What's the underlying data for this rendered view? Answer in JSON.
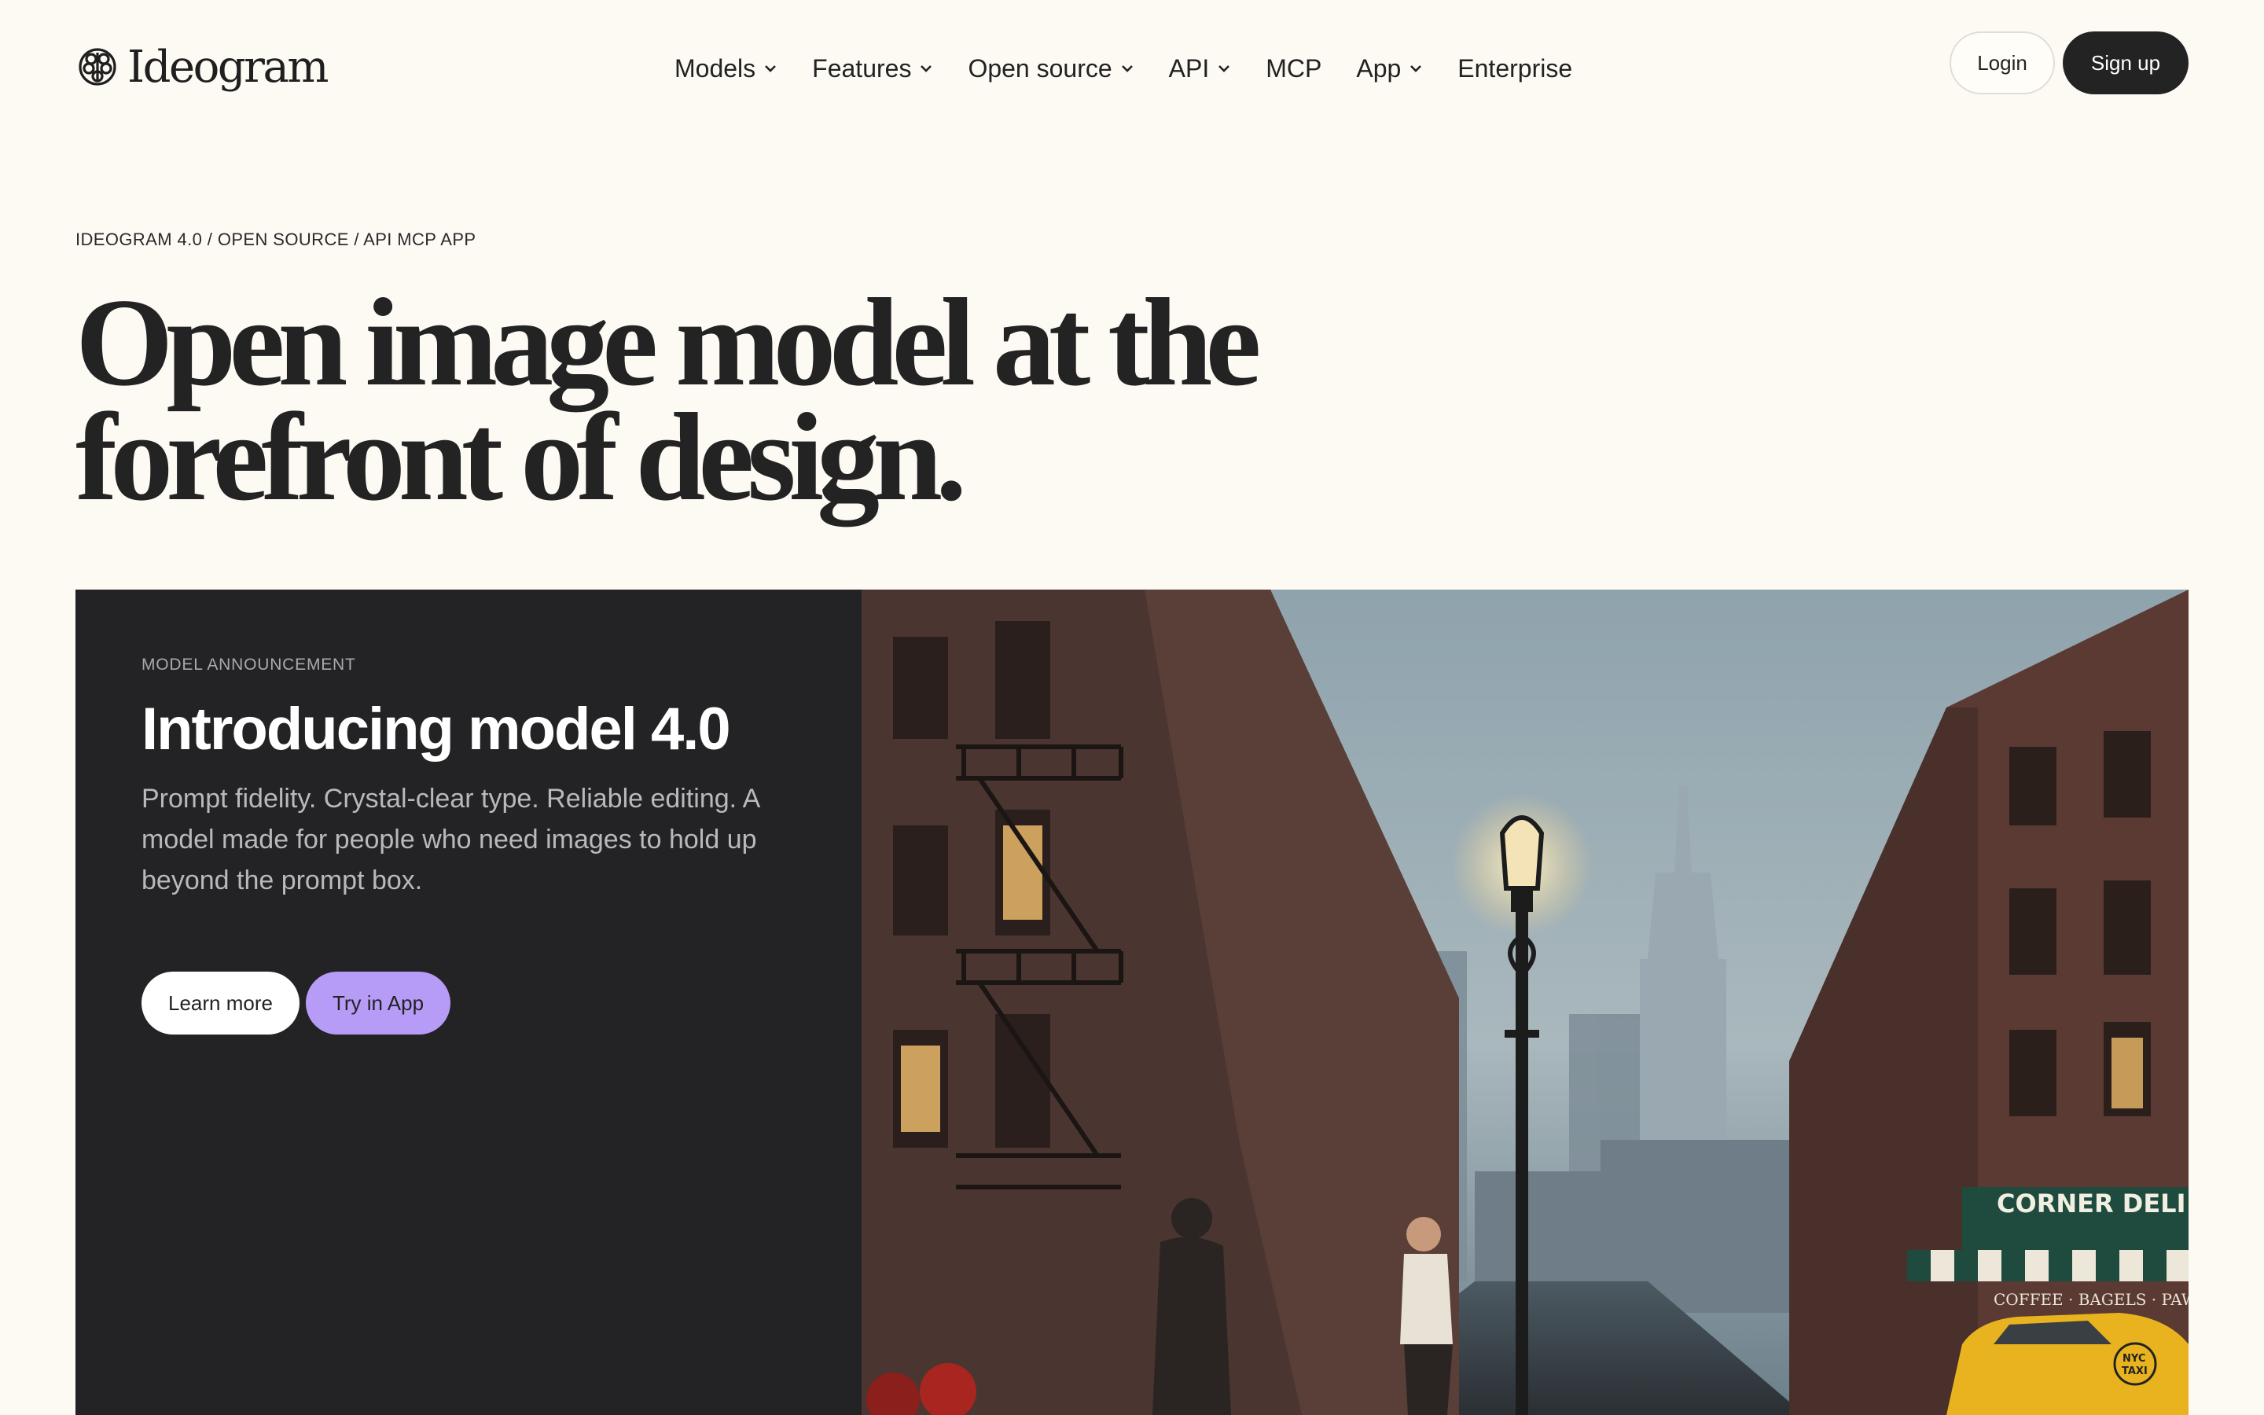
{
  "header": {
    "logo_text": "Ideogram",
    "logo_icon": "brain-logo-icon",
    "nav": [
      {
        "label": "Models",
        "has_dropdown": true
      },
      {
        "label": "Features",
        "has_dropdown": true
      },
      {
        "label": "Open source",
        "has_dropdown": true
      },
      {
        "label": "API",
        "has_dropdown": true
      },
      {
        "label": "MCP",
        "has_dropdown": false
      },
      {
        "label": "App",
        "has_dropdown": true
      },
      {
        "label": "Enterprise",
        "has_dropdown": false
      }
    ],
    "login_label": "Login",
    "signup_label": "Sign up"
  },
  "hero": {
    "breadcrumb": "IDEOGRAM 4.0 / OPEN SOURCE / API MCP APP",
    "headline_line1": "Open image model at the",
    "headline_line2": "forefront of design."
  },
  "announcement": {
    "eyebrow": "MODEL ANNOUNCEMENT",
    "title": "Introducing model 4.0",
    "description": "Prompt fidelity. Crystal-clear type. Reliable editing. A model made for people who need images to hold up beyond the prompt box.",
    "learn_more_label": "Learn more",
    "try_label": "Try in App"
  },
  "image": {
    "deli_sign": "CORNER DELI",
    "awning_text": "COFFEE · BAGELS · PAWNED",
    "taxi_badge_line1": "NYC",
    "taxi_badge_line2": "TAXI"
  },
  "colors": {
    "background": "#fdfaf4",
    "card_dark": "#232325",
    "signup": "#232323",
    "try_button": "#b69cf6"
  }
}
